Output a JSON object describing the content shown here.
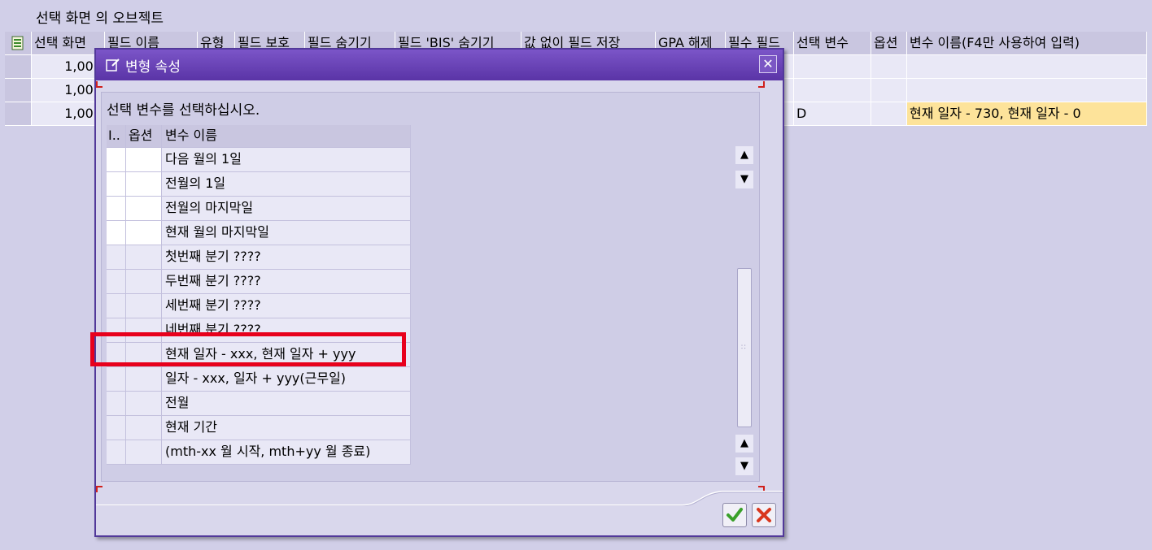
{
  "page_title": "선택 화면 의 오브젝트",
  "bg_table": {
    "headers": [
      "선택 화면",
      "필드 이름",
      "유형",
      "필드 보호",
      "필드 숨기기",
      "필드 'BIS' 숨기기",
      "값 없이 필드 저장",
      "GPA 해제",
      "필수 필드",
      "선택 변수",
      "옵션",
      "변수 이름(F4만 사용하여 입력)"
    ],
    "rows": [
      {
        "screen": "1,000",
        "sel_var": "",
        "var_name": ""
      },
      {
        "screen": "1,000",
        "sel_var": "",
        "var_name": ""
      },
      {
        "screen": "1,000",
        "sel_var": "D",
        "var_name": "현재 일자 - 730, 현재 일자 -  0"
      }
    ]
  },
  "dialog": {
    "title": "변형 속성",
    "instruction": "선택 변수를 선택하십시오.",
    "headers": [
      "I..",
      "옵션",
      "변수 이름"
    ],
    "rows": [
      {
        "label": "다음 월의 1일",
        "white": true
      },
      {
        "label": "전월의 1일",
        "white": true
      },
      {
        "label": "전월의 마지막일",
        "white": true
      },
      {
        "label": "현재 월의 마지막일",
        "white": true
      },
      {
        "label": "첫번째 분기   ????",
        "white": false
      },
      {
        "label": "두번째 분기   ????",
        "white": false
      },
      {
        "label": "세번째 분기   ????",
        "white": false
      },
      {
        "label": "네번째 분기   ????",
        "white": false
      },
      {
        "label": "현재 일자 - xxx, 현재 일자 + yyy",
        "white": false
      },
      {
        "label": "일자 - xxx, 일자 + yyy(근무일)",
        "white": false
      },
      {
        "label": "전월",
        "white": false
      },
      {
        "label": "현재 기간",
        "white": false
      },
      {
        "label": "(mth-xx 월 시작, mth+yy 월 종료)",
        "white": false
      }
    ],
    "close_glyph": "✕"
  },
  "colors": {
    "accent": "#5a34a6",
    "highlight": "#e8001c",
    "selected_cell": "#fde39a"
  }
}
